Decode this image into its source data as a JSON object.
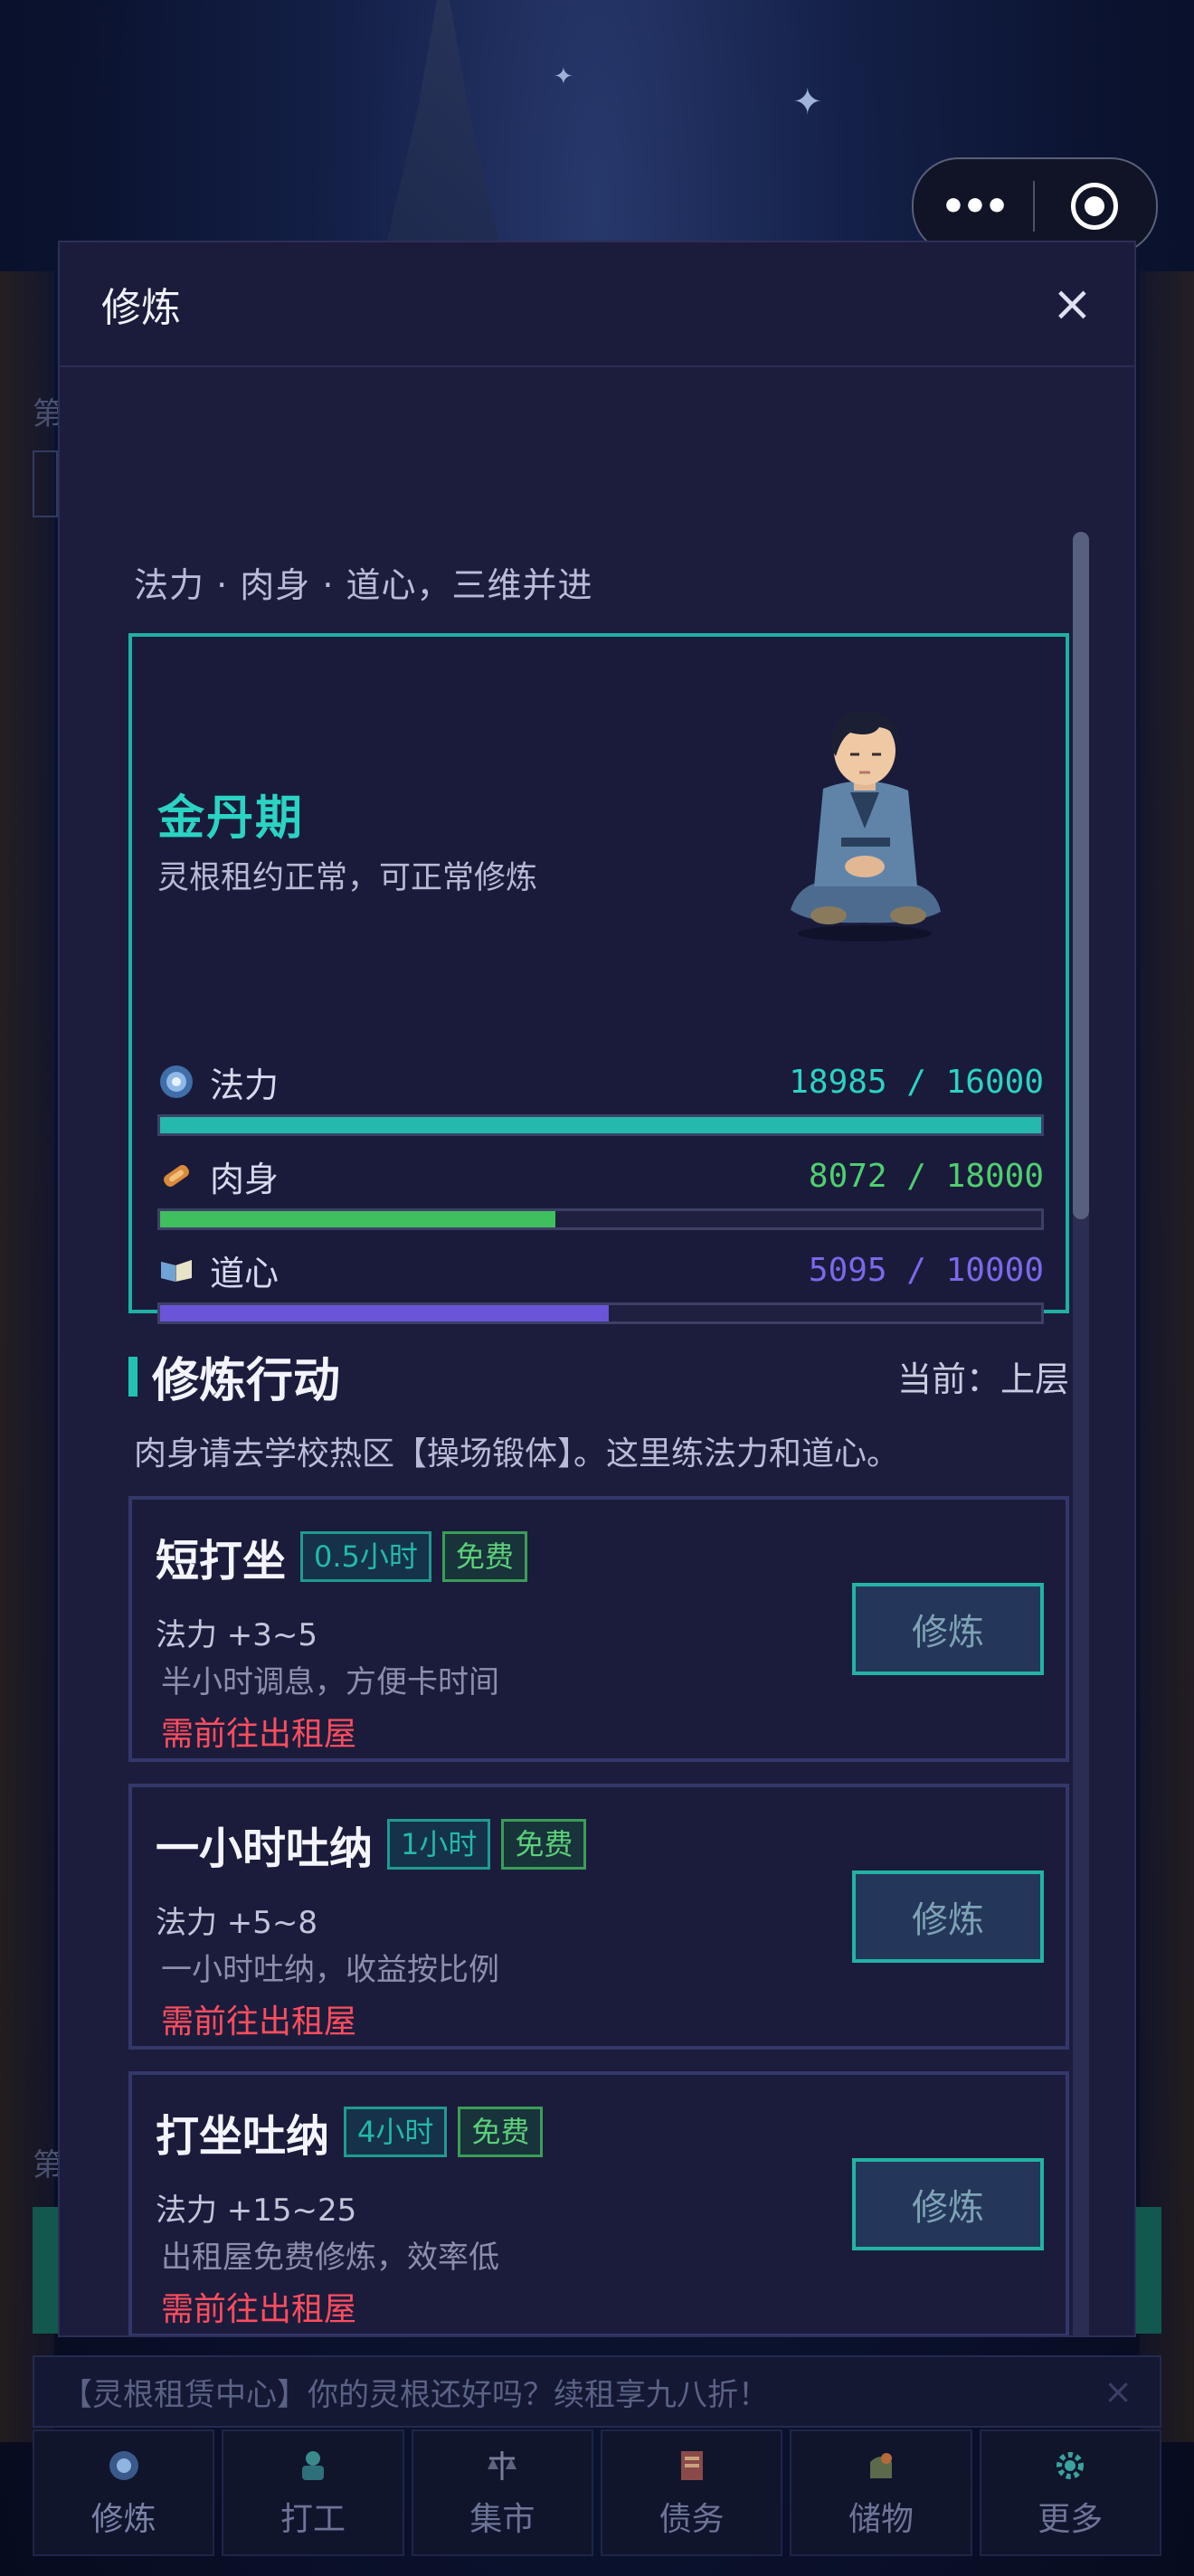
{
  "modal": {
    "title": "修炼",
    "close_glyph": "×"
  },
  "subtitle": "法力 · 肉身 · 道心，三维并进",
  "realm": {
    "name": "金丹期",
    "desc": "灵根租约正常，可正常修炼"
  },
  "stats": [
    {
      "label": "法力",
      "value_text": "18985 / 16000",
      "current": 18985,
      "max": 16000,
      "fill_fraction": 1.0,
      "color": "#25b8ad",
      "text_color": "#2bd3c3",
      "icon": "mana-orb-icon"
    },
    {
      "label": "肉身",
      "value_text": "8072 / 18000",
      "current": 8072,
      "max": 18000,
      "fill_fraction": 0.4484,
      "color": "#3fbf5e",
      "text_color": "#4fcf6e",
      "icon": "body-scroll-icon"
    },
    {
      "label": "道心",
      "value_text": "5095 / 10000",
      "current": 5095,
      "max": 10000,
      "fill_fraction": 0.5095,
      "color": "#6a55d8",
      "text_color": "#7c68ea",
      "icon": "dao-book-icon"
    }
  ],
  "section": {
    "title": "修炼行动",
    "current": "当前：上层",
    "note": "肉身请去学校热区【操场锻体】。这里练法力和道心。"
  },
  "actions": [
    {
      "name": "短打坐",
      "time": "0.5小时",
      "cost": "免费",
      "effect": "法力 +3~5",
      "desc": "半小时调息，方便卡时间",
      "req": "需前往出租屋",
      "button": "修炼"
    },
    {
      "name": "一小时吐纳",
      "time": "1小时",
      "cost": "免费",
      "effect": "法力 +5~8",
      "desc": "一小时吐纳，收益按比例",
      "req": "需前往出租屋",
      "button": "修炼"
    },
    {
      "name": "打坐吐纳",
      "time": "4小时",
      "cost": "免费",
      "effect": "法力 +15~25",
      "desc": "出租屋免费修炼，效率低",
      "req": "需前往出租屋",
      "button": "修炼"
    }
  ],
  "banner": {
    "text": "【灵根租赁中心】你的灵根还好吗？续租享九八折！",
    "close": "×"
  },
  "nav": [
    {
      "label": "修炼",
      "icon": "cultivate-icon"
    },
    {
      "label": "打工",
      "icon": "work-icon"
    },
    {
      "label": "集市",
      "icon": "market-scale-icon"
    },
    {
      "label": "债务",
      "icon": "debt-scroll-icon"
    },
    {
      "label": "储物",
      "icon": "storage-bag-icon"
    },
    {
      "label": "更多",
      "icon": "gear-icon"
    }
  ],
  "background_fragments": {
    "left_top": "第",
    "left_bottom": "第"
  }
}
